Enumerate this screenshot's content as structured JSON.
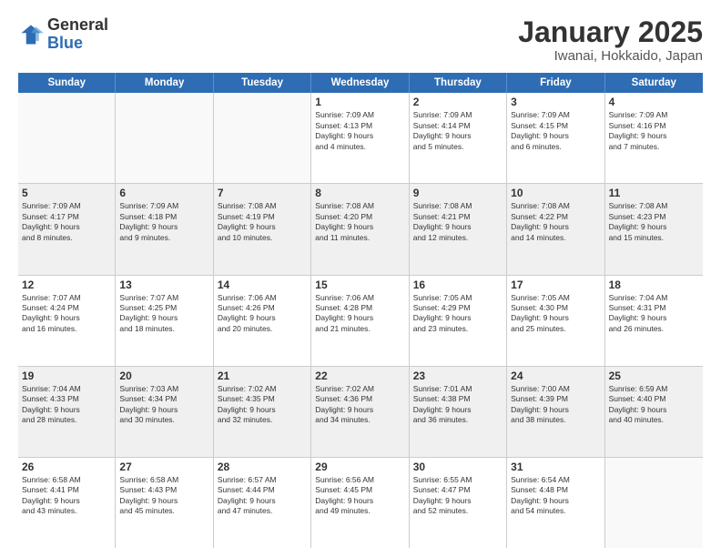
{
  "logo": {
    "general": "General",
    "blue": "Blue"
  },
  "title": "January 2025",
  "subtitle": "Iwanai, Hokkaido, Japan",
  "days": [
    "Sunday",
    "Monday",
    "Tuesday",
    "Wednesday",
    "Thursday",
    "Friday",
    "Saturday"
  ],
  "weeks": [
    [
      {
        "day": "",
        "info": ""
      },
      {
        "day": "",
        "info": ""
      },
      {
        "day": "",
        "info": ""
      },
      {
        "day": "1",
        "info": "Sunrise: 7:09 AM\nSunset: 4:13 PM\nDaylight: 9 hours\nand 4 minutes."
      },
      {
        "day": "2",
        "info": "Sunrise: 7:09 AM\nSunset: 4:14 PM\nDaylight: 9 hours\nand 5 minutes."
      },
      {
        "day": "3",
        "info": "Sunrise: 7:09 AM\nSunset: 4:15 PM\nDaylight: 9 hours\nand 6 minutes."
      },
      {
        "day": "4",
        "info": "Sunrise: 7:09 AM\nSunset: 4:16 PM\nDaylight: 9 hours\nand 7 minutes."
      }
    ],
    [
      {
        "day": "5",
        "info": "Sunrise: 7:09 AM\nSunset: 4:17 PM\nDaylight: 9 hours\nand 8 minutes."
      },
      {
        "day": "6",
        "info": "Sunrise: 7:09 AM\nSunset: 4:18 PM\nDaylight: 9 hours\nand 9 minutes."
      },
      {
        "day": "7",
        "info": "Sunrise: 7:08 AM\nSunset: 4:19 PM\nDaylight: 9 hours\nand 10 minutes."
      },
      {
        "day": "8",
        "info": "Sunrise: 7:08 AM\nSunset: 4:20 PM\nDaylight: 9 hours\nand 11 minutes."
      },
      {
        "day": "9",
        "info": "Sunrise: 7:08 AM\nSunset: 4:21 PM\nDaylight: 9 hours\nand 12 minutes."
      },
      {
        "day": "10",
        "info": "Sunrise: 7:08 AM\nSunset: 4:22 PM\nDaylight: 9 hours\nand 14 minutes."
      },
      {
        "day": "11",
        "info": "Sunrise: 7:08 AM\nSunset: 4:23 PM\nDaylight: 9 hours\nand 15 minutes."
      }
    ],
    [
      {
        "day": "12",
        "info": "Sunrise: 7:07 AM\nSunset: 4:24 PM\nDaylight: 9 hours\nand 16 minutes."
      },
      {
        "day": "13",
        "info": "Sunrise: 7:07 AM\nSunset: 4:25 PM\nDaylight: 9 hours\nand 18 minutes."
      },
      {
        "day": "14",
        "info": "Sunrise: 7:06 AM\nSunset: 4:26 PM\nDaylight: 9 hours\nand 20 minutes."
      },
      {
        "day": "15",
        "info": "Sunrise: 7:06 AM\nSunset: 4:28 PM\nDaylight: 9 hours\nand 21 minutes."
      },
      {
        "day": "16",
        "info": "Sunrise: 7:05 AM\nSunset: 4:29 PM\nDaylight: 9 hours\nand 23 minutes."
      },
      {
        "day": "17",
        "info": "Sunrise: 7:05 AM\nSunset: 4:30 PM\nDaylight: 9 hours\nand 25 minutes."
      },
      {
        "day": "18",
        "info": "Sunrise: 7:04 AM\nSunset: 4:31 PM\nDaylight: 9 hours\nand 26 minutes."
      }
    ],
    [
      {
        "day": "19",
        "info": "Sunrise: 7:04 AM\nSunset: 4:33 PM\nDaylight: 9 hours\nand 28 minutes."
      },
      {
        "day": "20",
        "info": "Sunrise: 7:03 AM\nSunset: 4:34 PM\nDaylight: 9 hours\nand 30 minutes."
      },
      {
        "day": "21",
        "info": "Sunrise: 7:02 AM\nSunset: 4:35 PM\nDaylight: 9 hours\nand 32 minutes."
      },
      {
        "day": "22",
        "info": "Sunrise: 7:02 AM\nSunset: 4:36 PM\nDaylight: 9 hours\nand 34 minutes."
      },
      {
        "day": "23",
        "info": "Sunrise: 7:01 AM\nSunset: 4:38 PM\nDaylight: 9 hours\nand 36 minutes."
      },
      {
        "day": "24",
        "info": "Sunrise: 7:00 AM\nSunset: 4:39 PM\nDaylight: 9 hours\nand 38 minutes."
      },
      {
        "day": "25",
        "info": "Sunrise: 6:59 AM\nSunset: 4:40 PM\nDaylight: 9 hours\nand 40 minutes."
      }
    ],
    [
      {
        "day": "26",
        "info": "Sunrise: 6:58 AM\nSunset: 4:41 PM\nDaylight: 9 hours\nand 43 minutes."
      },
      {
        "day": "27",
        "info": "Sunrise: 6:58 AM\nSunset: 4:43 PM\nDaylight: 9 hours\nand 45 minutes."
      },
      {
        "day": "28",
        "info": "Sunrise: 6:57 AM\nSunset: 4:44 PM\nDaylight: 9 hours\nand 47 minutes."
      },
      {
        "day": "29",
        "info": "Sunrise: 6:56 AM\nSunset: 4:45 PM\nDaylight: 9 hours\nand 49 minutes."
      },
      {
        "day": "30",
        "info": "Sunrise: 6:55 AM\nSunset: 4:47 PM\nDaylight: 9 hours\nand 52 minutes."
      },
      {
        "day": "31",
        "info": "Sunrise: 6:54 AM\nSunset: 4:48 PM\nDaylight: 9 hours\nand 54 minutes."
      },
      {
        "day": "",
        "info": ""
      }
    ]
  ]
}
